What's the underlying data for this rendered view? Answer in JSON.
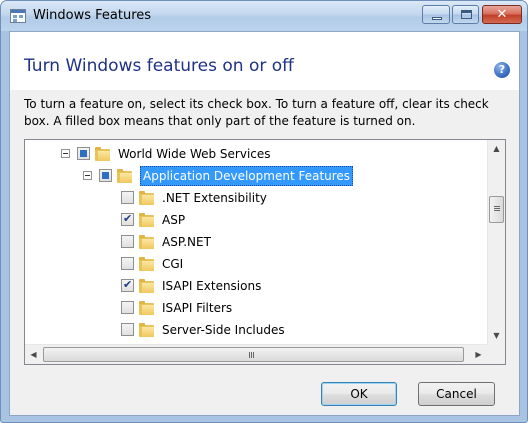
{
  "window": {
    "title": "Windows Features"
  },
  "header": {
    "heading": "Turn Windows features on or off",
    "help_glyph": "?"
  },
  "description": "To turn a feature on, select its check box. To turn a feature off, clear its check box. A filled box means that only part of the feature is turned on.",
  "tree": {
    "items": [
      {
        "label": "World Wide Web Services",
        "state": "partial",
        "expanded": true
      },
      {
        "label": "Application Development Features",
        "state": "partial",
        "expanded": true,
        "selected": true
      },
      {
        "label": ".NET Extensibility",
        "state": "unchecked"
      },
      {
        "label": "ASP",
        "state": "checked"
      },
      {
        "label": "ASP.NET",
        "state": "unchecked"
      },
      {
        "label": "CGI",
        "state": "unchecked"
      },
      {
        "label": "ISAPI Extensions",
        "state": "checked"
      },
      {
        "label": "ISAPI Filters",
        "state": "unchecked"
      },
      {
        "label": "Server-Side Includes",
        "state": "unchecked"
      }
    ]
  },
  "buttons": {
    "ok": "OK",
    "cancel": "Cancel"
  },
  "colors": {
    "heading": "#1e3287",
    "selection": "#3399ff",
    "close_button": "#c2402a"
  }
}
